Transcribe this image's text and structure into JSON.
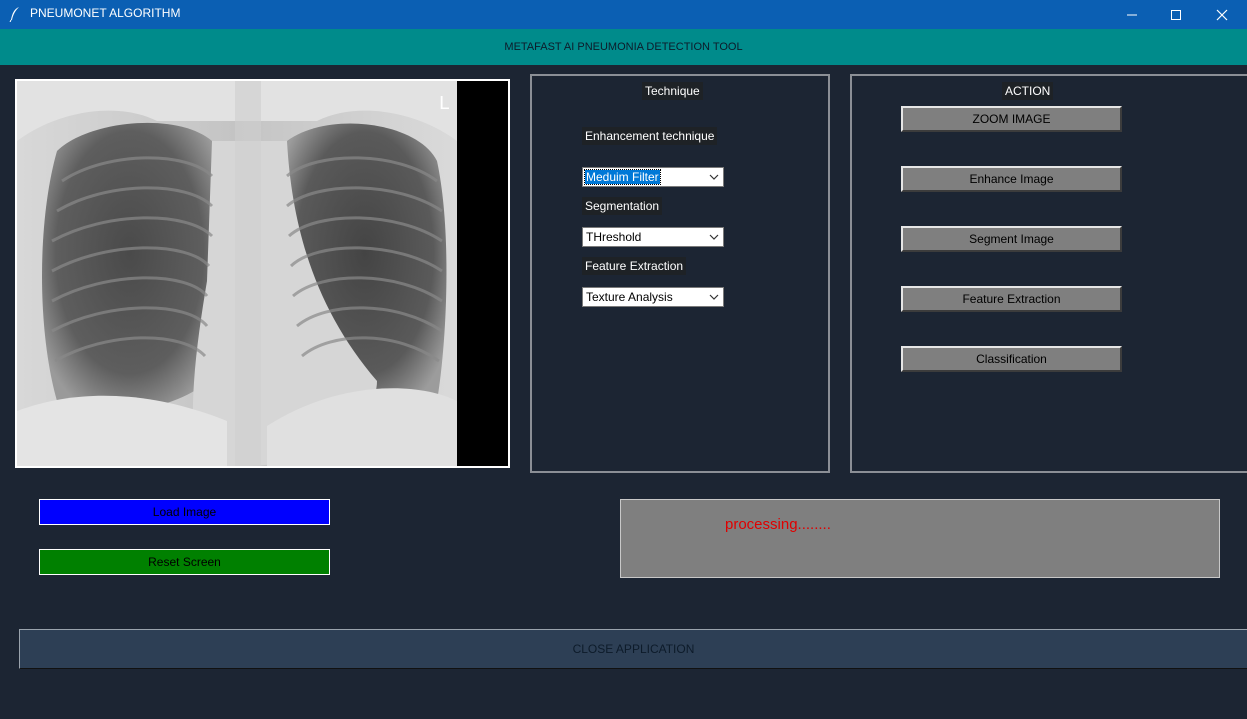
{
  "window": {
    "title": "PNEUMONET ALGORITHM",
    "icon": "feather-icon",
    "controls": [
      "minimize-icon",
      "maximize-icon",
      "close-icon"
    ]
  },
  "header": {
    "text": "METAFAST AI PNEUMONIA DETECTION TOOL"
  },
  "image_panel": {
    "marker": "L"
  },
  "technique_panel": {
    "title": "Technique",
    "enhancement_label": "Enhancement technique",
    "enhancement_value": "Meduim Filter",
    "segmentation_label": "Segmentation",
    "segmentation_value": "THreshold",
    "feature_label": "Feature Extraction",
    "feature_value": "Texture Analysis"
  },
  "action_panel": {
    "title": "ACTION",
    "buttons": [
      "ZOOM IMAGE",
      "Enhance Image",
      "Segment Image",
      "Feature Extraction",
      "Classification"
    ]
  },
  "controls": {
    "load_label": "Load Image",
    "load_color": "#0000ff",
    "reset_label": "Reset Screen",
    "reset_color": "#008000"
  },
  "status": {
    "text": "processing........",
    "color": "#e00000"
  },
  "footer": {
    "close_label": "CLOSE APPLICATION"
  }
}
